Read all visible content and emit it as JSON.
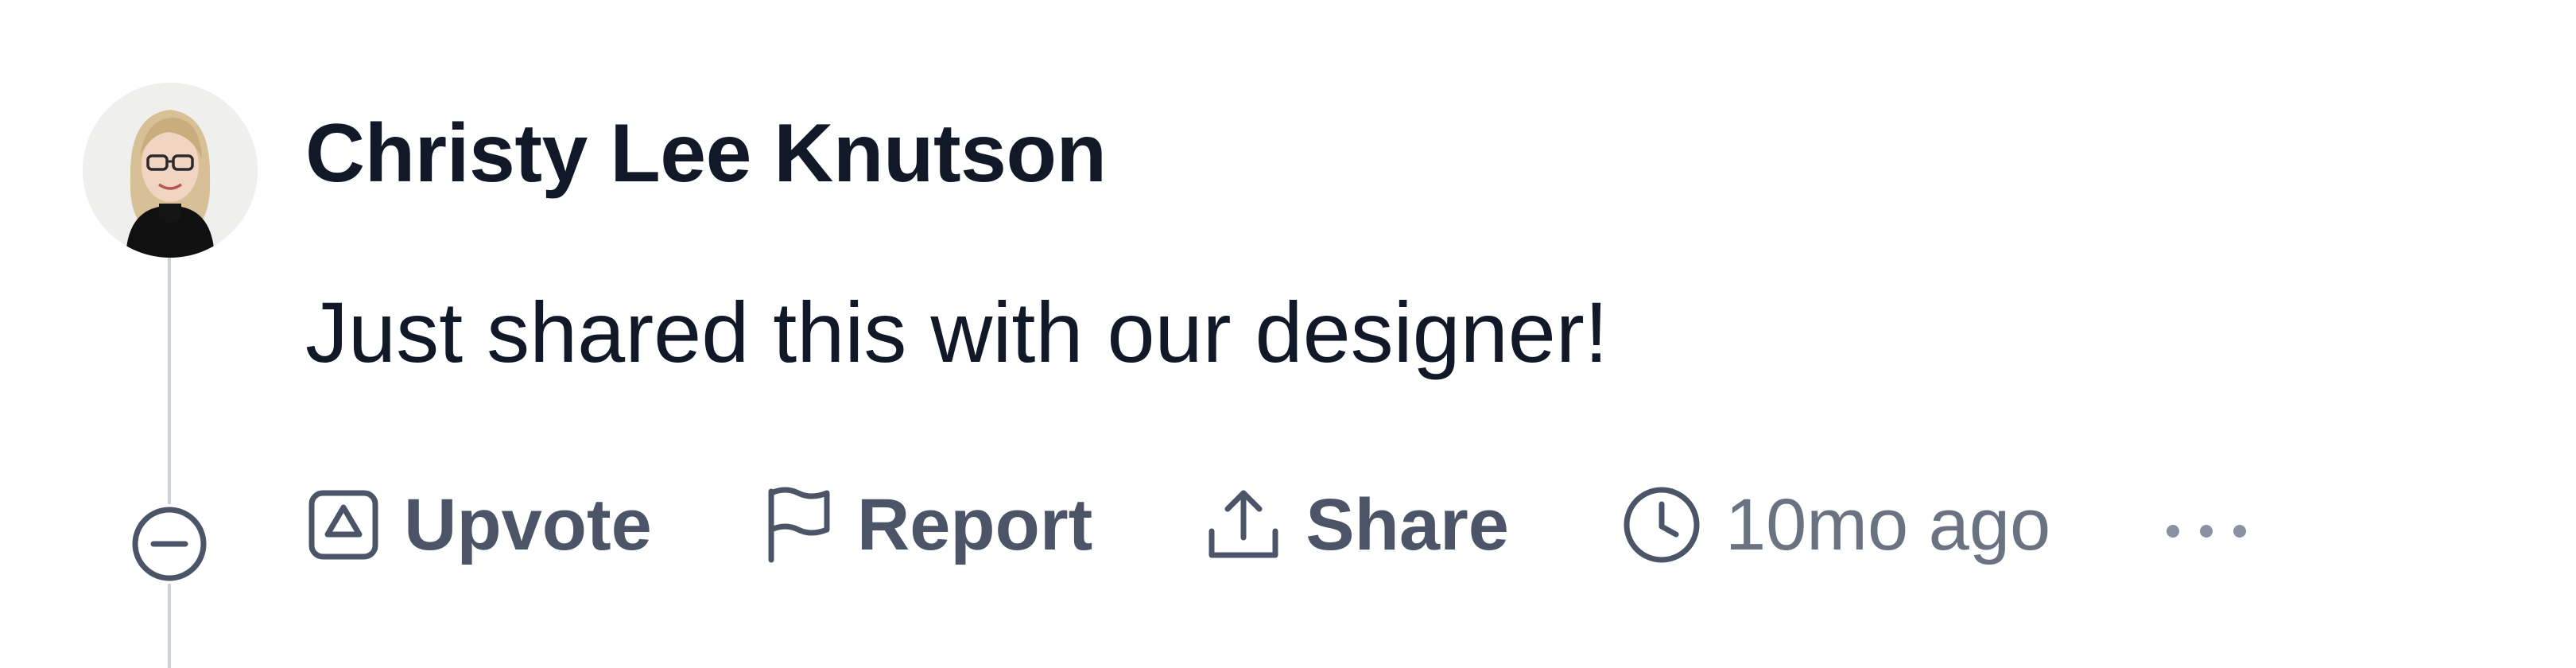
{
  "comment": {
    "author": "Christy Lee Knutson",
    "text": "Just shared this with our designer!",
    "timestamp": "10mo ago",
    "avatar_icon": "user-photo"
  },
  "actions": {
    "upvote_label": "Upvote",
    "report_label": "Report",
    "share_label": "Share"
  },
  "icons": {
    "upvote": "upvote-icon",
    "report": "flag-icon",
    "share": "share-icon",
    "time": "clock-icon",
    "more": "more-horizontal-icon",
    "collapse": "minus-circle-icon"
  },
  "colors": {
    "text_primary": "#111827",
    "text_secondary": "#4b5567",
    "timestamp": "#6b7383",
    "thread_line": "#cbd2db"
  }
}
